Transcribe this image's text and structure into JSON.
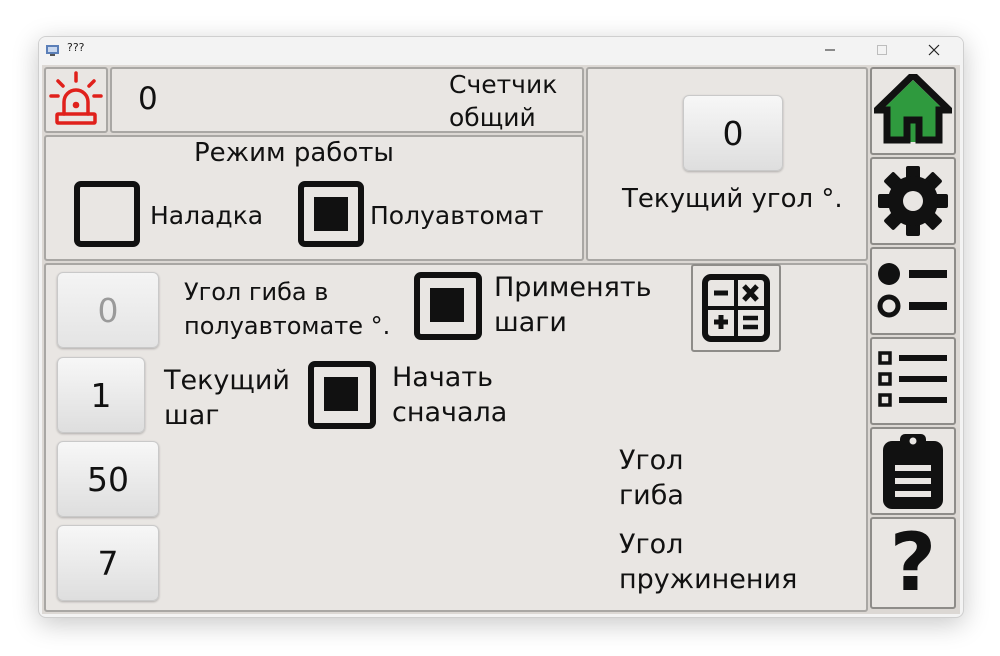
{
  "window": {
    "title": "???"
  },
  "counter": {
    "value": "0",
    "label": "Счетчик\nобщий"
  },
  "mode": {
    "title": "Режим работы",
    "setup_label": "Наладка",
    "setup_checked": false,
    "semiauto_label": "Полуавтомат",
    "semiauto_checked": true
  },
  "current_angle": {
    "value": "0",
    "label": "Текущий угол °."
  },
  "steps": {
    "bend_angle_semiauto_value": "0",
    "bend_angle_semiauto_label": "Угол гиба в\nполуавтомате °.",
    "apply_steps_label": "Применять\nшаги",
    "apply_steps_checked": true,
    "current_step_value": "1",
    "current_step_label": "Текущий\nшаг",
    "restart_label": "Начать\nсначала",
    "restart_checked": true,
    "bend_angle_value": "50",
    "bend_angle_label": "Угол\nгиба",
    "springback_value": "7",
    "springback_label": "Угол\nпружинения"
  },
  "sidebar": {
    "items": [
      {
        "icon": "home-icon"
      },
      {
        "icon": "gear-icon"
      },
      {
        "icon": "options-list-icon"
      },
      {
        "icon": "checklist-icon"
      },
      {
        "icon": "clipboard-icon"
      },
      {
        "icon": "help-icon",
        "glyph": "?"
      }
    ]
  },
  "colors": {
    "alarm": "#e0201b",
    "home_accent": "#2f9a3e",
    "background": "#dcd8d4",
    "panel": "#e9e6e3"
  }
}
